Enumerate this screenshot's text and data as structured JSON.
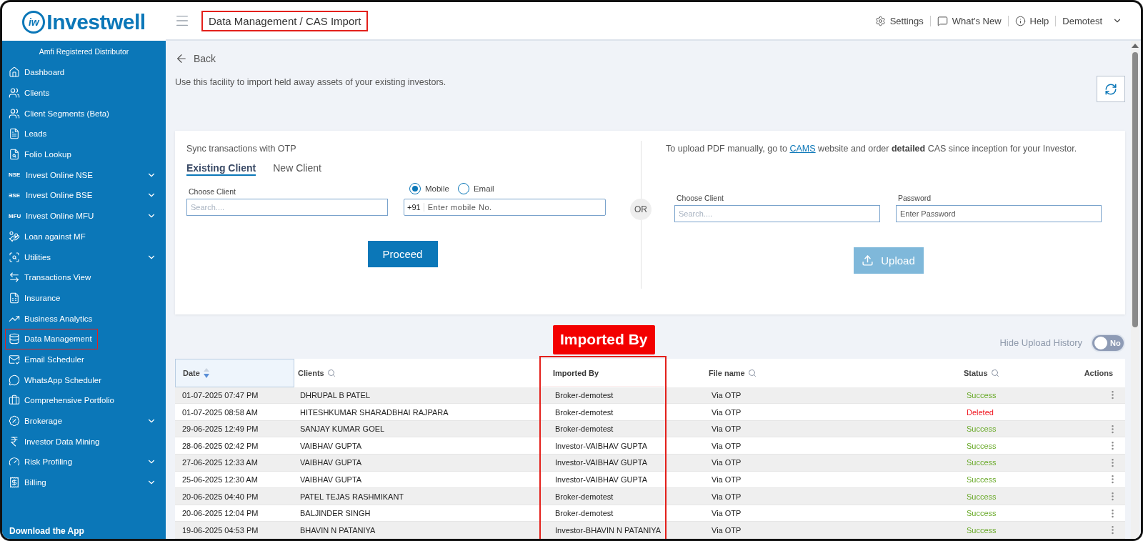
{
  "logo": {
    "mark": "iw",
    "text": "Investwell"
  },
  "header": {
    "breadcrumb": {
      "text": "Data Management / CAS Import",
      "highlighted": true
    },
    "links": [
      {
        "kind": "settings",
        "label": "Settings"
      },
      {
        "kind": "news",
        "label": "What's New"
      },
      {
        "kind": "help",
        "label": "Help"
      }
    ],
    "user": "Demotest"
  },
  "sidebar": {
    "caption": "Amfi Registered Distributor",
    "items": [
      {
        "label": "Dashboard",
        "expandable": false,
        "highlighted": false
      },
      {
        "label": "Clients",
        "expandable": false,
        "highlighted": false
      },
      {
        "label": "Client Segments (Beta)",
        "expandable": false,
        "highlighted": false
      },
      {
        "label": "Leads",
        "expandable": false,
        "highlighted": false
      },
      {
        "label": "Folio Lookup",
        "expandable": false,
        "highlighted": false
      },
      {
        "label": "Invest Online NSE",
        "tag": "NSE",
        "expandable": true,
        "highlighted": false
      },
      {
        "label": "Invest Online BSE",
        "tag": "ƎSE",
        "expandable": true,
        "highlighted": false
      },
      {
        "label": "Invest Online MFU",
        "tag": "MFU",
        "expandable": true,
        "highlighted": false
      },
      {
        "label": "Loan against MF",
        "expandable": false,
        "highlighted": false
      },
      {
        "label": "Utilities",
        "expandable": true,
        "highlighted": false
      },
      {
        "label": "Transactions View",
        "expandable": false,
        "highlighted": false
      },
      {
        "label": "Insurance",
        "expandable": false,
        "highlighted": false
      },
      {
        "label": "Business Analytics",
        "expandable": false,
        "highlighted": false
      },
      {
        "label": "Data Management",
        "expandable": false,
        "highlighted": true
      },
      {
        "label": "Email Scheduler",
        "expandable": false,
        "highlighted": false
      },
      {
        "label": "WhatsApp Scheduler",
        "expandable": false,
        "highlighted": false
      },
      {
        "label": "Comprehensive Portfolio",
        "expandable": false,
        "highlighted": false
      },
      {
        "label": "Brokerage",
        "expandable": true,
        "highlighted": false
      },
      {
        "label": "Investor Data Mining",
        "expandable": false,
        "highlighted": false
      },
      {
        "label": "Risk Profiling",
        "expandable": true,
        "highlighted": false
      },
      {
        "label": "Billing",
        "expandable": true,
        "highlighted": false
      }
    ],
    "footer": "Download the App"
  },
  "back": "Back",
  "description": "Use this facility to import held away assets of your existing investors.",
  "sync": {
    "title": "Sync transactions with OTP",
    "tabs": [
      {
        "label": "Existing Client",
        "selected": true
      },
      {
        "label": "New Client",
        "selected": false
      }
    ],
    "client_field": {
      "label": "Choose Client",
      "placeholder": "Search...."
    },
    "contact_options": [
      {
        "label": "Mobile",
        "selected": true
      },
      {
        "label": "Email",
        "selected": false
      }
    ],
    "mobile_field": {
      "prefix": "+91",
      "placeholder": "Enter mobile No."
    },
    "button": "Proceed"
  },
  "divider_label": "OR",
  "upload": {
    "note_before": "To upload PDF manually, go to",
    "link": "CAMS",
    "note_after": "website and order **detailed** CAS since inception for your Investor.",
    "client_field": {
      "label": "Choose Client",
      "placeholder": "Search...."
    },
    "password_field": {
      "label": "Password",
      "placeholder": "Enter Password"
    },
    "button": "Upload",
    "disabled": true
  },
  "history_toggle": {
    "label": "Hide Upload History",
    "on": false,
    "state_text": "No"
  },
  "table": {
    "columns": [
      {
        "label": "Date",
        "kind": "sortable",
        "highlighted": false
      },
      {
        "label": "Clients",
        "kind": "searchable",
        "highlighted": false
      },
      {
        "label": "Imported By",
        "kind": "plain",
        "highlighted": true,
        "callout": "Imported By"
      },
      {
        "label": "File name",
        "kind": "searchable",
        "highlighted": false
      },
      {
        "label": "Status",
        "kind": "searchable",
        "highlighted": false
      },
      {
        "label": "Actions",
        "kind": "actions",
        "highlighted": false
      }
    ],
    "rows": [
      {
        "date": "01-07-2025 07:47 PM",
        "client": "DHRUPAL B PATEL",
        "imported_by": "Broker-demotest",
        "file": "Via OTP",
        "status": "Success",
        "color": "#6aaa2a",
        "has_actions": true
      },
      {
        "date": "01-07-2025 08:58 AM",
        "client": "HITESHKUMAR SHARADBHAI RAJPARA",
        "imported_by": "Broker-demotest",
        "file": "Via OTP",
        "status": "Deleted",
        "color": "#f0141e",
        "has_actions": false
      },
      {
        "date": "29-06-2025 12:49 PM",
        "client": "SANJAY KUMAR GOEL",
        "imported_by": "Broker-demotest",
        "file": "Via OTP",
        "status": "Success",
        "color": "#6aaa2a",
        "has_actions": true
      },
      {
        "date": "28-06-2025 02:42 PM",
        "client": "VAIBHAV GUPTA",
        "imported_by": "Investor-VAIBHAV GUPTA",
        "file": "Via OTP",
        "status": "Success",
        "color": "#6aaa2a",
        "has_actions": true
      },
      {
        "date": "27-06-2025 12:33 AM",
        "client": "VAIBHAV GUPTA",
        "imported_by": "Investor-VAIBHAV GUPTA",
        "file": "Via OTP",
        "status": "Success",
        "color": "#6aaa2a",
        "has_actions": true
      },
      {
        "date": "25-06-2025 12:30 AM",
        "client": "VAIBHAV GUPTA",
        "imported_by": "Investor-VAIBHAV GUPTA",
        "file": "Via OTP",
        "status": "Success",
        "color": "#6aaa2a",
        "has_actions": true
      },
      {
        "date": "20-06-2025 04:40 PM",
        "client": "PATEL TEJAS RASHMIKANT",
        "imported_by": "Broker-demotest",
        "file": "Via OTP",
        "status": "Success",
        "color": "#6aaa2a",
        "has_actions": true
      },
      {
        "date": "20-06-2025 12:04 PM",
        "client": "BALJINDER SINGH",
        "imported_by": "Broker-demotest",
        "file": "Via OTP",
        "status": "Success",
        "color": "#6aaa2a",
        "has_actions": true
      },
      {
        "date": "19-06-2025 04:53 PM",
        "client": "BHAVIN N PATANIYA",
        "imported_by": "Investor-BHAVIN N PATANIYA",
        "file": "Via OTP",
        "status": "Success",
        "color": "#6aaa2a",
        "has_actions": true
      }
    ]
  }
}
